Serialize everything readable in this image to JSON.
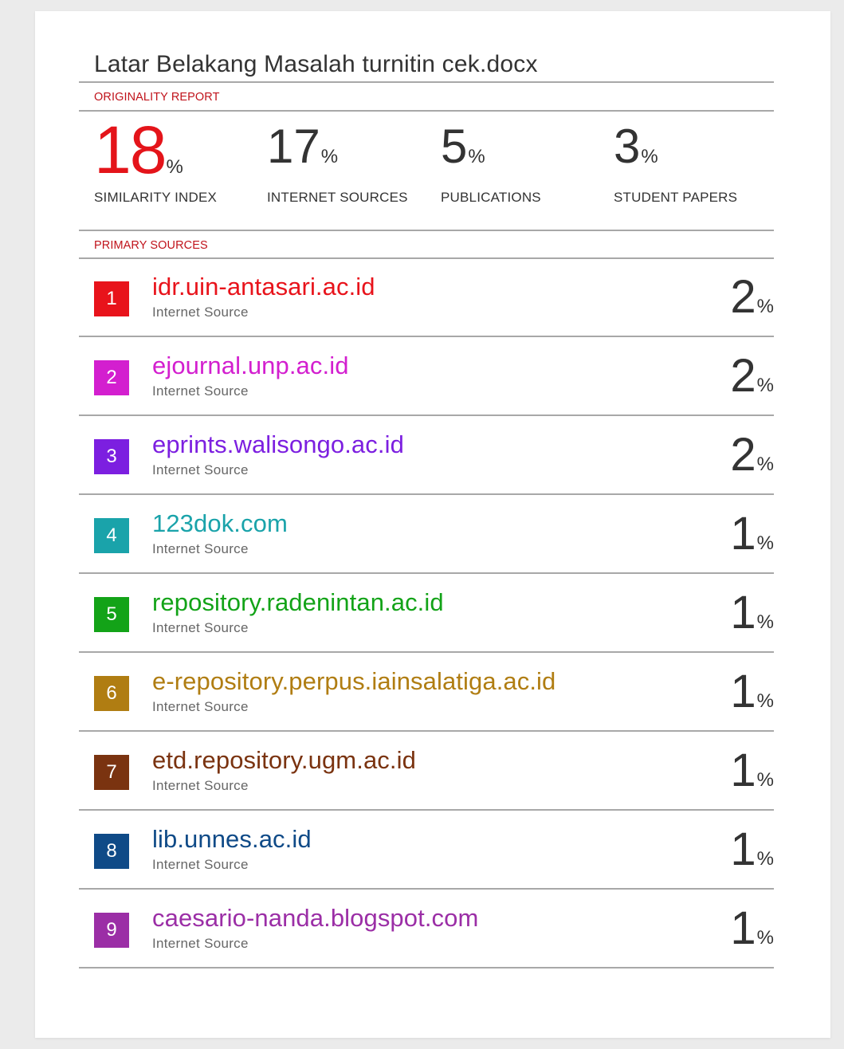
{
  "document": {
    "title": "Latar Belakang Masalah turnitin cek.docx"
  },
  "report": {
    "originality_label": "ORIGINALITY REPORT",
    "primary_sources_label": "PRIMARY SOURCES",
    "percent_sign": "%",
    "stats": [
      {
        "value": "18",
        "label": "SIMILARITY INDEX"
      },
      {
        "value": "17",
        "label": "INTERNET SOURCES"
      },
      {
        "value": "5",
        "label": "PUBLICATIONS"
      },
      {
        "value": "3",
        "label": "STUDENT PAPERS"
      }
    ]
  },
  "sources": [
    {
      "rank": "1",
      "name": "idr.uin-antasari.ac.id",
      "type": "Internet Source",
      "percent": "2",
      "color": "#e8131b"
    },
    {
      "rank": "2",
      "name": "ejournal.unp.ac.id",
      "type": "Internet Source",
      "percent": "2",
      "color": "#d31fcf"
    },
    {
      "rank": "3",
      "name": "eprints.walisongo.ac.id",
      "type": "Internet Source",
      "percent": "2",
      "color": "#7c1fe0"
    },
    {
      "rank": "4",
      "name": "123dok.com",
      "type": "Internet Source",
      "percent": "1",
      "color": "#1aa3aa"
    },
    {
      "rank": "5",
      "name": "repository.radenintan.ac.id",
      "type": "Internet Source",
      "percent": "1",
      "color": "#13a318"
    },
    {
      "rank": "6",
      "name": "e-repository.perpus.iainsalatiga.ac.id",
      "type": "Internet Source",
      "percent": "1",
      "color": "#b07d12"
    },
    {
      "rank": "7",
      "name": "etd.repository.ugm.ac.id",
      "type": "Internet Source",
      "percent": "1",
      "color": "#7a3310"
    },
    {
      "rank": "8",
      "name": "lib.unnes.ac.id",
      "type": "Internet Source",
      "percent": "1",
      "color": "#0f4a87"
    },
    {
      "rank": "9",
      "name": "caesario-nanda.blogspot.com",
      "type": "Internet Source",
      "percent": "1",
      "color": "#9b2ea6"
    }
  ]
}
